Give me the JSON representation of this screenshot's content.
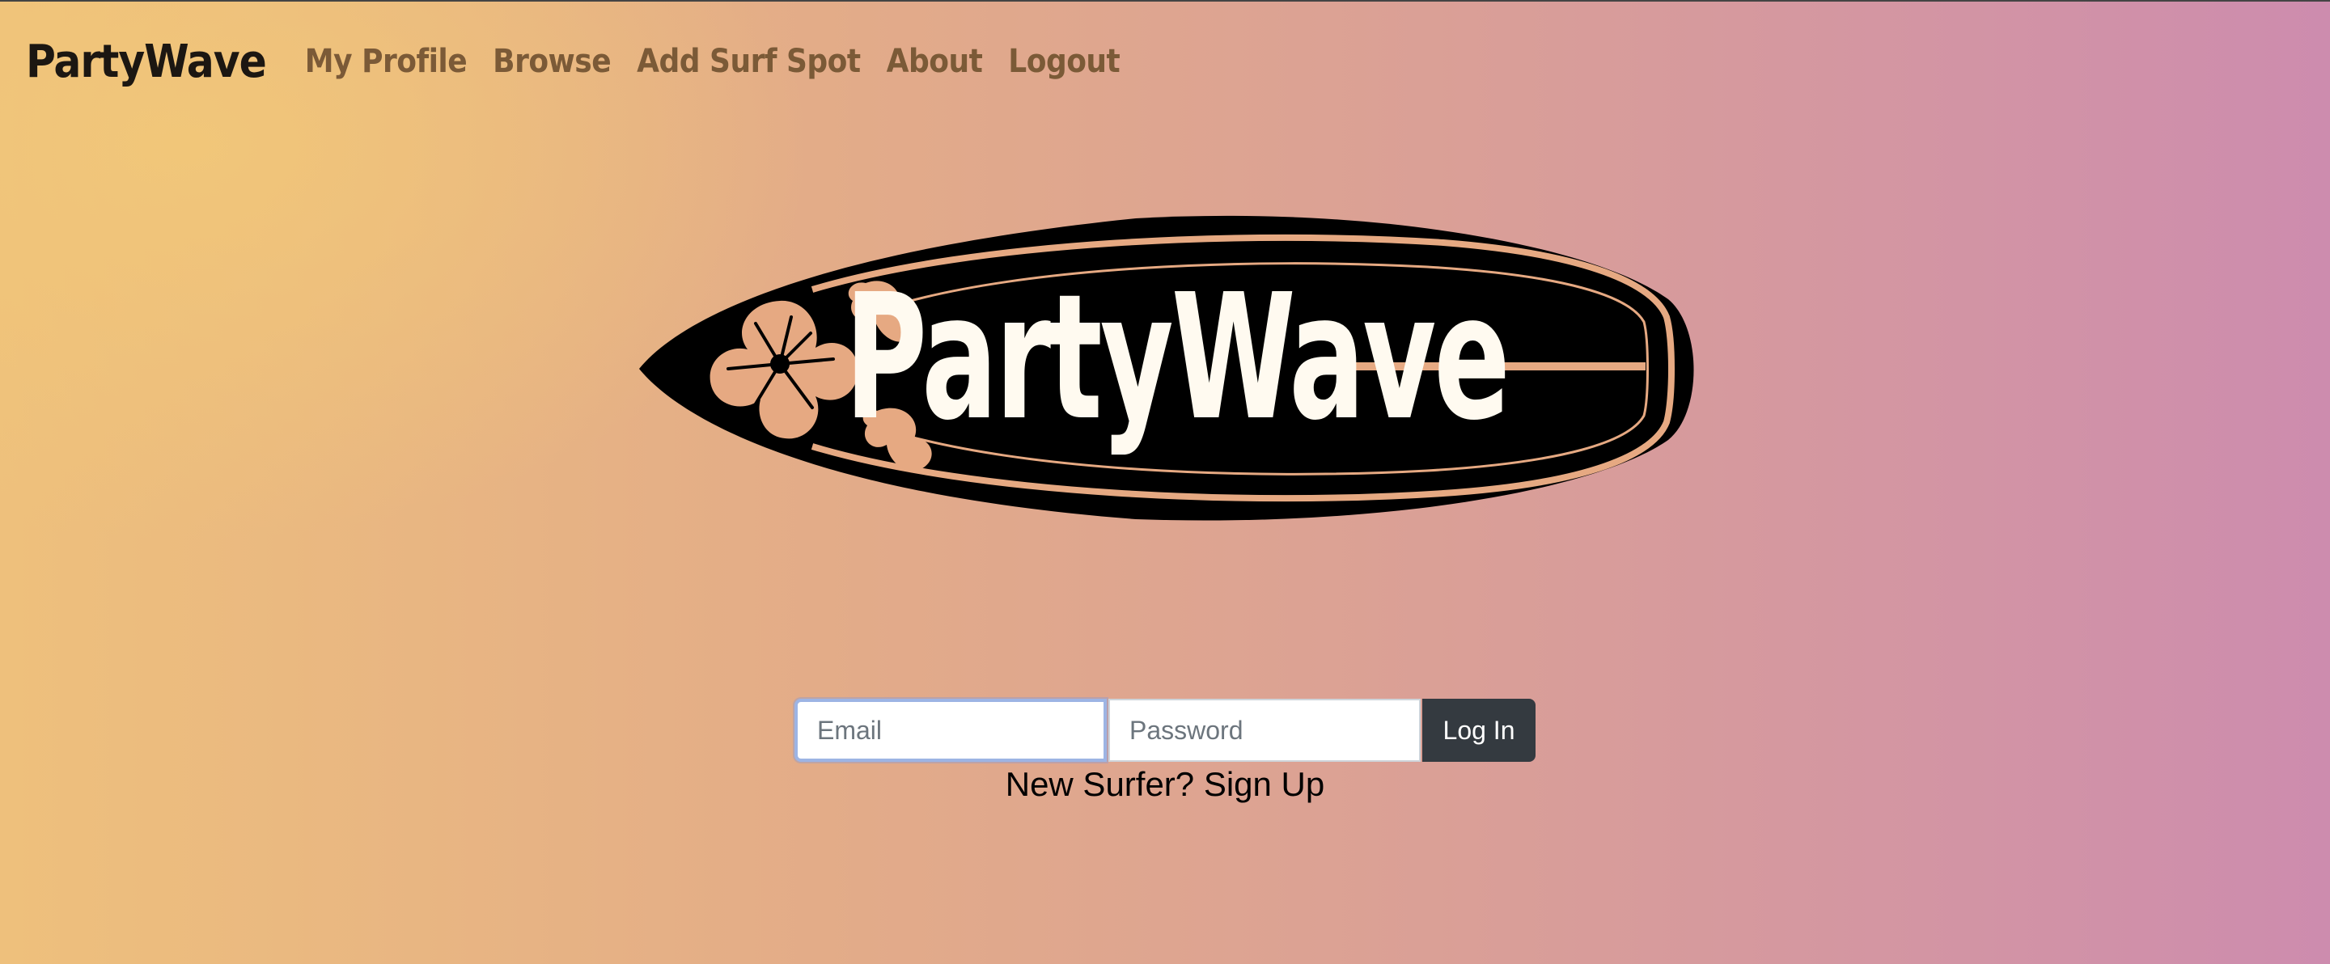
{
  "nav": {
    "brand": "PartyWave",
    "links": [
      "My Profile",
      "Browse",
      "Add Surf Spot",
      "About",
      "Logout"
    ]
  },
  "logo": {
    "text": "PartyWave",
    "icon": "surfboard-hibiscus-logo"
  },
  "login": {
    "email_placeholder": "Email",
    "password_placeholder": "Password",
    "email_value": "",
    "password_value": "",
    "button_label": "Log In"
  },
  "signup": {
    "prompt": "New Surfer?",
    "link_label": "Sign Up"
  },
  "colors": {
    "gradient_start": "#eec07c",
    "gradient_end": "#cd8cae",
    "button": "#343a40",
    "nav_link": "#7b5a37",
    "logo_board": "#000000",
    "logo_accent": "#e6a982"
  }
}
